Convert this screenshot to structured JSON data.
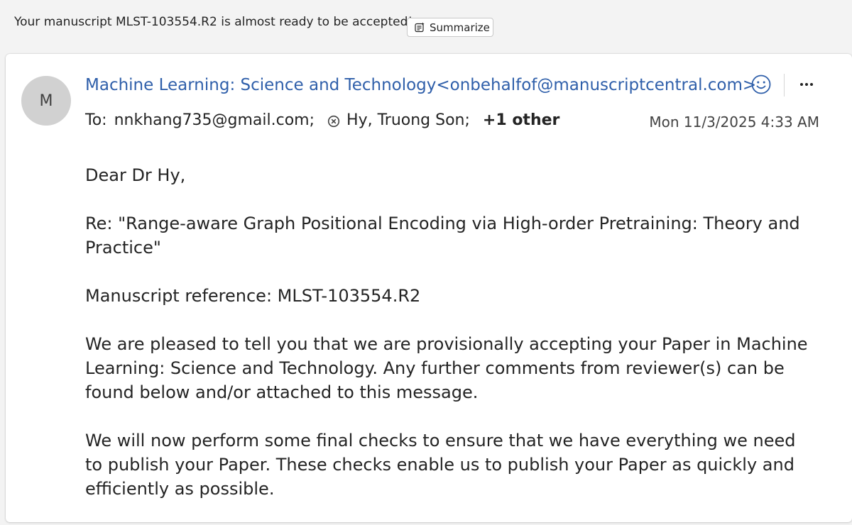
{
  "subject": {
    "text": "Your manuscript MLST-103554.R2 is almost ready to be accepted!",
    "summarize_label": "Summarize",
    "summarize_icon": "summarize-icon"
  },
  "message": {
    "avatar_initial": "M",
    "sender": "Machine Learning: Science and Technology<onbehalfof@manuscriptcentral.com>",
    "to_label": "To:",
    "recipients": [
      "nnkhang735@gmail.com;",
      "Hy, Truong Son;"
    ],
    "more_recipients": "+1 other",
    "date": "Mon 11/3/2025 4:33 AM",
    "icons": {
      "react": "smiley-icon",
      "more": "more-options-icon",
      "remove_recipient": "remove-circle-icon"
    },
    "body": {
      "greeting": "Dear Dr Hy,",
      "re_line": "Re: \"Range-aware Graph Positional Encoding via High-order Pretraining: Theory and Practice\"",
      "reference": "Manuscript reference: MLST-103554.R2",
      "paragraph1": "We are pleased to tell you that we are provisionally accepting your Paper in Machine Learning: Science and Technology. Any further comments from reviewer(s) can be found below and/or attached to this message.",
      "paragraph2": "We will now perform some final checks to ensure that we have everything we need to publish your Paper. These checks enable us to publish your Paper as quickly and efficiently as possible."
    }
  },
  "colors": {
    "sender_link": "#2f5faa",
    "avatar_bg": "#d1d1d1",
    "background": "#f3f3f3",
    "card": "#ffffff"
  }
}
